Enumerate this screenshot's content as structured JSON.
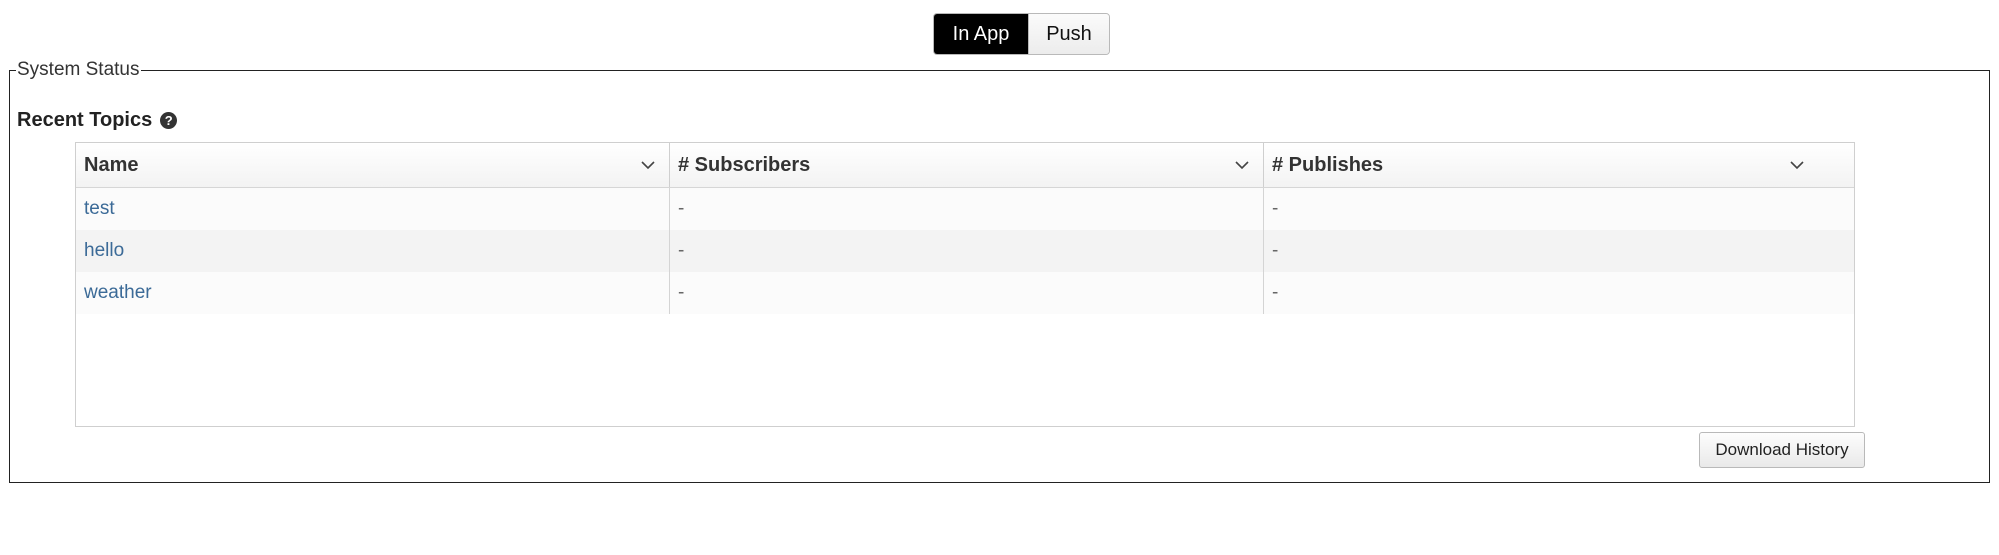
{
  "mode_toggle": {
    "options": [
      {
        "label": "In App",
        "selected": true
      },
      {
        "label": "Push",
        "selected": false
      }
    ]
  },
  "panel": {
    "legend": "System Status",
    "section_title": "Recent Topics",
    "help_icon": "question-circle-icon"
  },
  "table": {
    "columns": [
      {
        "label": "Name"
      },
      {
        "label": "# Subscribers"
      },
      {
        "label": "# Publishes"
      }
    ],
    "rows": [
      {
        "name": "test",
        "subscribers": "-",
        "publishes": "-"
      },
      {
        "name": "hello",
        "subscribers": "-",
        "publishes": "-"
      },
      {
        "name": "weather",
        "subscribers": "-",
        "publishes": "-"
      }
    ]
  },
  "actions": {
    "download_label": "Download History"
  },
  "colors": {
    "toggle_active_bg": "#000000",
    "link": "#3b6a97",
    "border": "#222222"
  }
}
